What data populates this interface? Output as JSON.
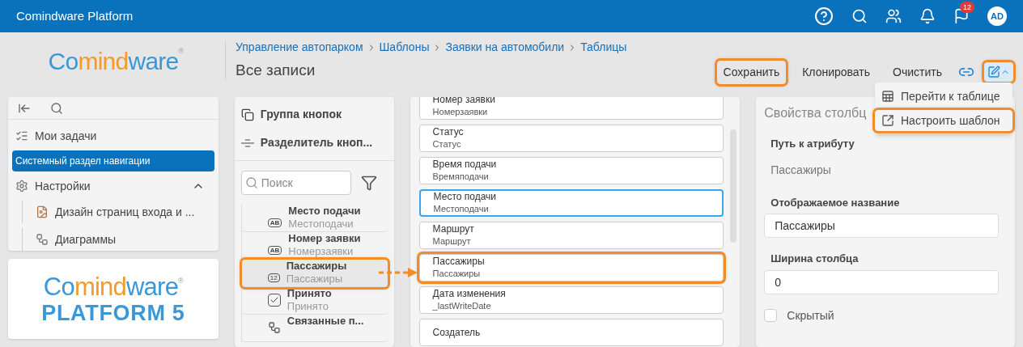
{
  "app_bar": {
    "title": "Comindware Platform",
    "notifications": "12",
    "avatar": "AD"
  },
  "logo": {
    "parts": [
      {
        "text": "Co",
        "color": "#3a98d8"
      },
      {
        "text": "mind",
        "color": "#f39a2c"
      },
      {
        "text": "ware",
        "color": "#3a98d8"
      }
    ],
    "mark": "®"
  },
  "breadcrumbs": [
    "Управление автопарком",
    "Шаблоны",
    "Заявки на автомобили",
    "Таблицы"
  ],
  "page_title": "Все записи",
  "toolbar": [
    {
      "label": "Сохранить",
      "highlighted": true
    },
    {
      "label": "Клонировать",
      "highlighted": false
    },
    {
      "label": "Очистить",
      "highlighted": false
    }
  ],
  "edit_menu": {
    "highlighted": true,
    "items": [
      {
        "kind": "table",
        "label": "Перейти к таблице",
        "highlighted": false
      },
      {
        "kind": "external",
        "label": "Настроить шаблон",
        "highlighted": true
      }
    ]
  },
  "nav": {
    "items": [
      {
        "kind": "tasks",
        "label": "Мои задачи",
        "selected": false
      },
      {
        "kind": "section",
        "label": "Системный раздел навигации",
        "selected": true
      },
      {
        "kind": "settings",
        "label": "Настройки",
        "selected": false,
        "expanded": true,
        "children": [
          {
            "kind": "page",
            "label": "Дизайн страниц входа и ...",
            "selected": false
          },
          {
            "kind": "diagram",
            "label": "Диаграммы",
            "selected": false
          }
        ]
      }
    ]
  },
  "brand_card": {
    "parts": [
      {
        "text": "Co",
        "color": "#3a98d8"
      },
      {
        "text": "mind",
        "color": "#f39a2c"
      },
      {
        "text": "ware",
        "color": "#3a98d8"
      }
    ],
    "mark": "®",
    "subtitle": "PLATFORM 5"
  },
  "components": {
    "tools": [
      {
        "kind": "group",
        "label": "Группа кнопок"
      },
      {
        "kind": "divider",
        "label": "Разделитель кноп..."
      }
    ],
    "search": {
      "placeholder": "Поиск"
    },
    "attributes": [
      {
        "kind": "text",
        "badge": "AB",
        "label": "Место подачи",
        "alias": "Местоподачи",
        "highlighted": false
      },
      {
        "kind": "text",
        "badge": "AB",
        "label": "Номер заявки",
        "alias": "Номерзаявки",
        "highlighted": false
      },
      {
        "kind": "number",
        "badge": "12",
        "label": "Пассажиры",
        "alias": "Пассажиры",
        "highlighted": true
      },
      {
        "kind": "bool",
        "label": "Принято",
        "alias": "Принято",
        "highlighted": false
      },
      {
        "kind": "link",
        "label": "Связанные п...",
        "highlighted": false
      }
    ]
  },
  "columns": [
    {
      "label": "Номер заявки",
      "alias": "Номерзаявки",
      "selected": false,
      "highlighted": false
    },
    {
      "label": "Статус",
      "alias": "Статус",
      "selected": false,
      "highlighted": false
    },
    {
      "label": "Время подачи",
      "alias": "Времяподачи",
      "selected": false,
      "highlighted": false
    },
    {
      "label": "Место подачи",
      "alias": "Местоподачи",
      "selected": true,
      "highlighted": false
    },
    {
      "label": "Маршрут",
      "alias": "Маршрут",
      "selected": false,
      "highlighted": false
    },
    {
      "label": "Пассажиры",
      "alias": "Пассажиры",
      "selected": false,
      "highlighted": true
    },
    {
      "label": "Дата изменения",
      "alias": "_lastWriteDate",
      "selected": false,
      "highlighted": false
    },
    {
      "label": "Создатель",
      "selected": false,
      "highlighted": false
    }
  ],
  "properties": {
    "title": "Свойства столбц",
    "path_label": "Путь к атрибуту",
    "path_value": "Пассажиры",
    "name_label": "Отображаемое название",
    "name_value": "Пассажиры",
    "width_label": "Ширина столбца",
    "width_value": "0",
    "hidden_label": "Скрытый",
    "hidden": false
  }
}
